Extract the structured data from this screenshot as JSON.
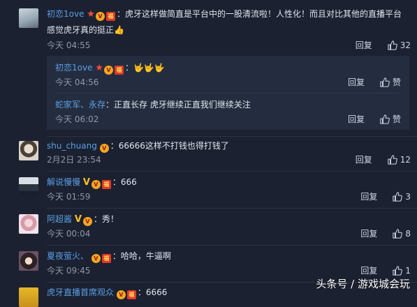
{
  "comments": [
    {
      "username": "初恋1ove",
      "text": "：虎牙这样做简直是平台中的一股清流啦！人性化！而且对比其他的直播平台",
      "text_cont": "感觉虎牙真的挺正👍",
      "time": "今天 04:55",
      "reply_label": "回复",
      "likes": "32"
    },
    {
      "username": "shu_chuang",
      "text": "：66666这样不打钱也得打钱了",
      "time": "2月2日 23:54",
      "reply_label": "回复",
      "likes": "12"
    },
    {
      "username": "解说慢慢",
      "text": "：666",
      "time": "今天 01:59",
      "reply_label": "回复",
      "likes": "3"
    },
    {
      "username": "阿超酱",
      "text": "：秀！",
      "time": "今天 00:04",
      "reply_label": "回复",
      "likes": "8"
    },
    {
      "username": "夏夜萤火、",
      "text": "：哈哈，牛逼啊",
      "time": "今天 09:45",
      "reply_label": "回复",
      "likes": "1"
    },
    {
      "username": "虎牙直播首席观众",
      "text": "：6666"
    }
  ],
  "replies": [
    {
      "username": "初恋1ove",
      "text": "：🤟🤟🤟",
      "time": "今天 04:56",
      "reply_label": "回复",
      "like_label": "赞"
    },
    {
      "username": "蛇家军、永存",
      "text": "：正直长存  虎牙继续正直我们继续关注",
      "time": "今天 06:02",
      "reply_label": "回复",
      "like_label": "赞"
    }
  ],
  "watermark": "头条号 / 游戏城会玩",
  "colors": {
    "background": "#1b2130",
    "username": "#5b9ee6",
    "reply_box": "#242d3f",
    "time": "#8e98ab"
  },
  "icons": [
    "thumbs-up-icon",
    "star-badge-icon",
    "vip-badge-icon",
    "red-packet-badge-icon",
    "v-badge-icon"
  ]
}
